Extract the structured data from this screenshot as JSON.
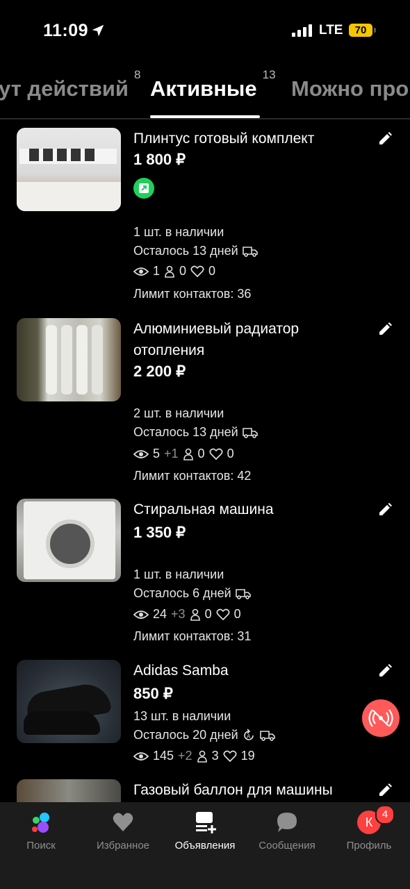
{
  "status_bar": {
    "time": "11:09",
    "network": "LTE",
    "battery": "70"
  },
  "tabs": [
    {
      "label": "ут действий",
      "count": "8"
    },
    {
      "label": "Активные",
      "count": "13",
      "active": true
    },
    {
      "label": "Можно про",
      "count": ""
    }
  ],
  "listings": [
    {
      "title": "Плинтус готовый комплект",
      "price": "1 800 ₽",
      "stock": "1 шт. в наличии",
      "days_left": "Осталось 13 дней",
      "views": "1",
      "views_delta": "",
      "contacts": "0",
      "favorites": "0",
      "contact_limit": "Лимит контактов: 36"
    },
    {
      "title": "Алюминиевый радиатор отопления",
      "price": "2 200 ₽",
      "stock": "2 шт. в наличии",
      "days_left": "Осталось 13 дней",
      "views": "5",
      "views_delta": "+1",
      "contacts": "0",
      "favorites": "0",
      "contact_limit": "Лимит контактов: 42"
    },
    {
      "title": "Стиральная машина",
      "price": "1 350 ₽",
      "stock": "1 шт. в наличии",
      "days_left": "Осталось 6 дней",
      "views": "24",
      "views_delta": "+3",
      "contacts": "0",
      "favorites": "0",
      "contact_limit": "Лимит контактов: 31"
    },
    {
      "title": "Adidas Samba",
      "price": "850 ₽",
      "stock": "13 шт. в наличии",
      "days_left": "Осталось 20 дней",
      "views": "145",
      "views_delta": "+2",
      "contacts": "3",
      "favorites": "19"
    },
    {
      "title": "Газовый баллон для машины"
    }
  ],
  "bottom_nav": {
    "search": "Поиск",
    "favorites": "Избранное",
    "ads": "Объявления",
    "messages": "Сообщения",
    "profile": "Профиль",
    "profile_initial": "К",
    "profile_badge": "4"
  },
  "colors": {
    "accent_red": "#ff5a5a",
    "promo_green": "#1fd15c",
    "battery": "#f5c500"
  },
  "icons": [
    "location-arrow-icon",
    "pencil-icon",
    "eye-icon",
    "person-icon",
    "heart-icon",
    "delivery-truck-icon",
    "autorenew-icon",
    "promo-arrow-icon",
    "broadcast-off-icon"
  ]
}
